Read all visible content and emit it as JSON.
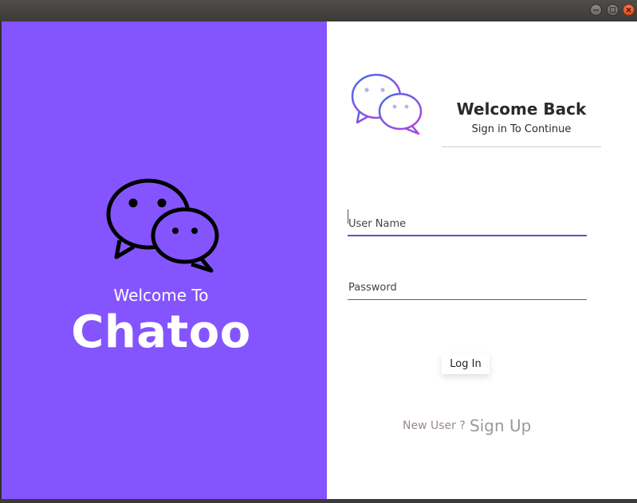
{
  "window": {
    "controls": {
      "minimize_icon": "minimize-icon",
      "maximize_icon": "maximize-icon",
      "close_icon": "close-icon"
    },
    "close_color": "#e95420"
  },
  "left_panel": {
    "background": "#8455fe",
    "icon": "chat-bubbles-icon",
    "welcome_text": "Welcome To",
    "brand_name": "Chatoo"
  },
  "right_panel": {
    "logo_icon": "chat-bubbles-gradient-icon",
    "title": "Welcome Back",
    "subtitle": "Sign in To Continue",
    "username": {
      "placeholder": "User Name",
      "value": ""
    },
    "password": {
      "placeholder": "Password",
      "value": ""
    },
    "login_label": "Log In",
    "new_user_text": "New User ?",
    "signup_label": "Sign Up",
    "accent_color": "#6f48c8"
  }
}
